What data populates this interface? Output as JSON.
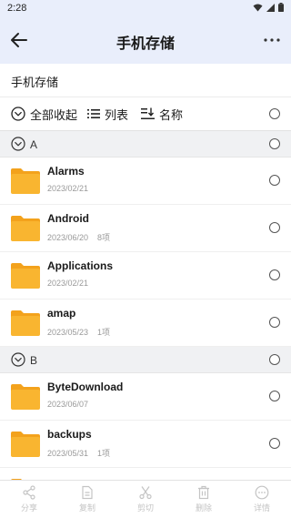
{
  "status": {
    "time": "2:28"
  },
  "header": {
    "title": "手机存储"
  },
  "path": {
    "label": "手机存储"
  },
  "toolbar": {
    "collapse_all": "全部收起",
    "list_view": "列表",
    "sort": "名称"
  },
  "groups": [
    {
      "letter": "A",
      "items": [
        {
          "name": "Alarms",
          "date": "2023/02/21",
          "count": ""
        },
        {
          "name": "Android",
          "date": "2023/06/20",
          "count": "8项"
        },
        {
          "name": "Applications",
          "date": "2023/02/21",
          "count": ""
        },
        {
          "name": "amap",
          "date": "2023/05/23",
          "count": "1项"
        }
      ]
    },
    {
      "letter": "B",
      "items": [
        {
          "name": "ByteDownload",
          "date": "2023/06/07",
          "count": ""
        },
        {
          "name": "backups",
          "date": "2023/05/31",
          "count": "1项"
        }
      ]
    }
  ],
  "bottom_actions": {
    "share": "分享",
    "copy": "复制",
    "cut": "剪切",
    "delete": "删除",
    "details": "详情"
  },
  "colors": {
    "folder": "#f9b530",
    "folder_tab": "#f3a21c",
    "header_bg": "#e9eefb",
    "disabled": "#c4c4c4"
  }
}
